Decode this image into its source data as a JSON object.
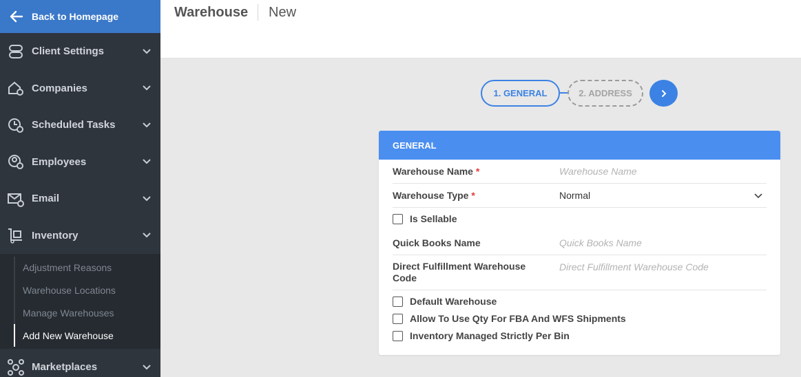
{
  "sidebar": {
    "back_label": "Back to Homepage",
    "items": [
      {
        "label": "Client Settings",
        "icon": "client-settings-icon"
      },
      {
        "label": "Companies",
        "icon": "companies-icon"
      },
      {
        "label": "Scheduled Tasks",
        "icon": "scheduled-tasks-icon"
      },
      {
        "label": "Employees",
        "icon": "employees-icon"
      },
      {
        "label": "Email",
        "icon": "email-icon"
      },
      {
        "label": "Inventory",
        "icon": "inventory-icon"
      }
    ],
    "sub_items": [
      {
        "label": "Adjustment Reasons"
      },
      {
        "label": "Warehouse Locations"
      },
      {
        "label": "Manage Warehouses"
      },
      {
        "label": "Add New Warehouse"
      }
    ],
    "marketplaces_label": "Marketplaces"
  },
  "header": {
    "title": "Warehouse",
    "subtitle": "New"
  },
  "stepper": {
    "step1": "1. GENERAL",
    "step2": "2. ADDRESS"
  },
  "form": {
    "section_title": "GENERAL",
    "warehouse_name_label": "Warehouse Name",
    "warehouse_name_placeholder": "Warehouse Name",
    "warehouse_type_label": "Warehouse Type",
    "warehouse_type_value": "Normal",
    "required_mark": "*",
    "is_sellable_label": "Is Sellable",
    "quickbooks_label": "Quick Books Name",
    "quickbooks_placeholder": "Quick Books Name",
    "direct_label_line1": "Direct Fulfillment Warehouse",
    "direct_label_line2": "Code",
    "direct_placeholder": "Direct Fulfillment Warehouse Code",
    "default_warehouse_label": "Default Warehouse",
    "allow_qty_label": "Allow To Use Qty For FBA And WFS Shipments",
    "inventory_managed_label": "Inventory Managed Strictly Per Bin"
  },
  "colors": {
    "accent": "#3b82e4",
    "sidebar_bg": "#2f353d",
    "back_bg": "#3a78c9",
    "card_head": "#4a8ef0"
  }
}
